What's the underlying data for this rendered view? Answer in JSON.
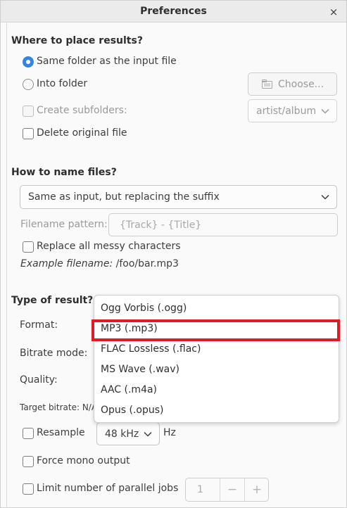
{
  "window": {
    "title": "Preferences",
    "close_label": "×"
  },
  "placement": {
    "heading": "Where to place results?",
    "same_folder_label": "Same folder as the input file",
    "same_folder_selected": true,
    "into_folder_label": "Into folder",
    "into_folder_selected": false,
    "choose_button": "Choose...",
    "create_subfolders_label": "Create subfolders:",
    "create_subfolders_checked": false,
    "subfolder_pattern": "artist/album",
    "delete_original_label": "Delete original file",
    "delete_original_checked": false
  },
  "naming": {
    "heading": "How to name files?",
    "scheme_selected": "Same as input, but replacing the suffix",
    "pattern_label": "Filename pattern:",
    "pattern_placeholder": "{Track} - {Title}",
    "replace_messy_label": "Replace all messy characters",
    "replace_messy_checked": false,
    "example_label": "Example filename:",
    "example_value": "/foo/bar.mp3"
  },
  "result": {
    "heading": "Type of result?",
    "format_label": "Format:",
    "bitrate_mode_label": "Bitrate mode:",
    "quality_label": "Quality:",
    "target_bitrate_label": "Target bitrate: N/A",
    "format_options": [
      "Ogg Vorbis (.ogg)",
      "MP3 (.mp3)",
      "FLAC Lossless (.flac)",
      "MS Wave (.wav)",
      "AAC (.m4a)",
      "Opus (.opus)"
    ],
    "highlighted_option": "MP3 (.mp3)",
    "highlight_color": "#e01b24"
  },
  "resample": {
    "label": "Resample",
    "checked": false,
    "rate": "48 kHz",
    "unit": "Hz"
  },
  "force_mono": {
    "label": "Force mono output",
    "checked": false
  },
  "parallel_jobs": {
    "label": "Limit number of parallel jobs",
    "checked": false,
    "value": "1",
    "decrement": "−",
    "increment": "+"
  },
  "colors": {
    "accent": "#3584e4",
    "highlight": "#e01b24"
  }
}
